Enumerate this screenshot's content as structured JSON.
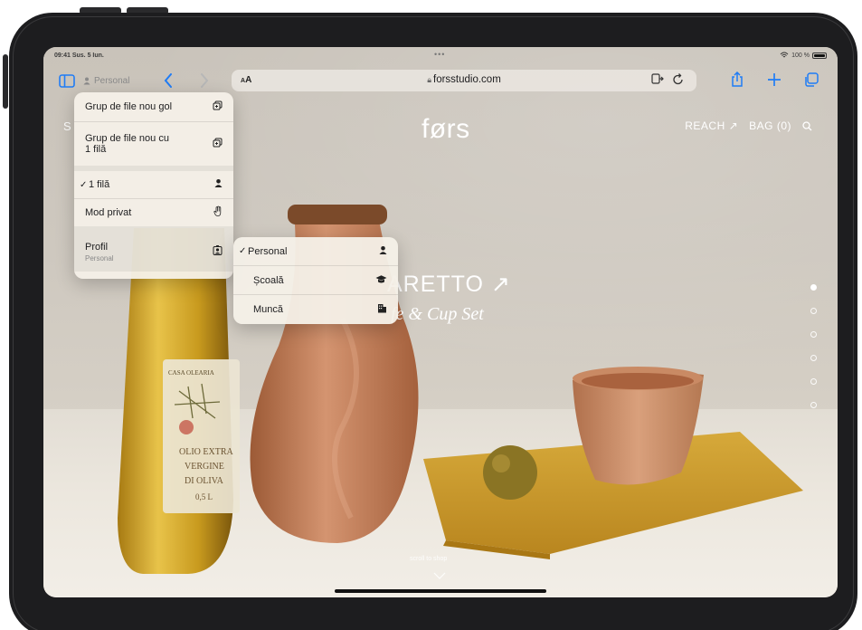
{
  "status": {
    "time": "09:41 Sus. 5 Iun.",
    "dots": "•••",
    "battery": "100 %"
  },
  "toolbar": {
    "profile": "Personal",
    "aa_label": "AA",
    "url": "forsstudio.com"
  },
  "site": {
    "left_letter": "S",
    "logo": "førs",
    "reach": "REACH ↗",
    "bag": "BAG (0)",
    "hero_title": "ARETTO ↗",
    "hero_subtitle": "fe & Cup Set",
    "scroll_hint": "scroll to shop",
    "bottle_label_top": "CASA OLEARIA",
    "bottle_label_text": [
      "OLIO EXTRA",
      "VERGINE",
      "DI OLIVA",
      "0,5 L"
    ]
  },
  "tab_menu": {
    "items": [
      {
        "label": "Grup de file nou gol",
        "icon": "new-tab-group-icon"
      },
      {
        "label": "Grup de file nou cu 1 filă",
        "icon": "new-tab-group-icon"
      },
      {
        "label": "1 filă",
        "icon": "person-icon",
        "checked": true
      },
      {
        "label": "Mod privat",
        "icon": "hand-icon"
      },
      {
        "label": "Profil",
        "sublabel": "Personal",
        "icon": "profile-badge-icon"
      }
    ]
  },
  "profile_menu": {
    "items": [
      {
        "label": "Personal",
        "icon": "person-icon",
        "checked": true
      },
      {
        "label": "Școală",
        "icon": "graduation-cap-icon"
      },
      {
        "label": "Muncă",
        "icon": "building-icon"
      }
    ]
  },
  "colors": {
    "accent": "#1f7cf6",
    "menu_bg": "#f4f0e8"
  }
}
